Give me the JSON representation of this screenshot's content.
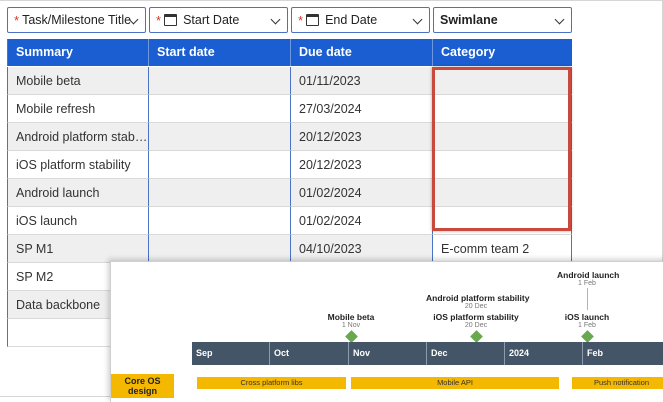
{
  "mapping": {
    "fields": [
      {
        "label": "Task/Milestone Title",
        "required": true,
        "icon": "none"
      },
      {
        "label": "Start Date",
        "required": true,
        "icon": "calendar-icon"
      },
      {
        "label": "End Date",
        "required": true,
        "icon": "calendar-icon"
      },
      {
        "label": "Swimlane",
        "required": false,
        "icon": "none"
      }
    ],
    "required_marker": "*"
  },
  "table": {
    "headers": [
      "Summary",
      "Start date",
      "Due date",
      "Category"
    ],
    "rows": [
      {
        "summary": "Mobile beta",
        "start": "",
        "due": "01/11/2023",
        "category": ""
      },
      {
        "summary": "Mobile refresh",
        "start": "",
        "due": "27/03/2024",
        "category": ""
      },
      {
        "summary": "Android platform stabi…",
        "start": "",
        "due": "20/12/2023",
        "category": ""
      },
      {
        "summary": "iOS platform stability",
        "start": "",
        "due": "20/12/2023",
        "category": ""
      },
      {
        "summary": "Android launch",
        "start": "",
        "due": "01/02/2024",
        "category": ""
      },
      {
        "summary": "iOS launch",
        "start": "",
        "due": "01/02/2024",
        "category": ""
      },
      {
        "summary": "SP M1",
        "start": "",
        "due": "04/10/2023",
        "category": "E-comm team 2"
      },
      {
        "summary": "SP M2",
        "start": "",
        "due": "",
        "category": ""
      },
      {
        "summary": "Data backbone",
        "start": "",
        "due": "",
        "category": ""
      }
    ]
  },
  "timeline": {
    "milestones": [
      {
        "title": "Android launch",
        "date": "1 Feb"
      },
      {
        "title": "Android platform stability",
        "date": "20 Dec"
      },
      {
        "title": "Mobile beta",
        "date": "1 Nov"
      },
      {
        "title": "iOS platform stability",
        "date": "20 Dec"
      },
      {
        "title": "iOS launch",
        "date": "1 Feb"
      }
    ],
    "months": [
      "Sep",
      "Oct",
      "Nov",
      "Dec",
      "2024",
      "Feb"
    ],
    "swimlane": "Core OS design",
    "tasks": [
      "Cross platform libs",
      "Mobile API",
      "Push notification"
    ]
  },
  "colors": {
    "header_blue": "#1b5ed1",
    "highlight_red": "#c94a3c",
    "axis": "#455568",
    "milestone_green": "#6aa84f",
    "task_yellow": "#f5b800"
  }
}
